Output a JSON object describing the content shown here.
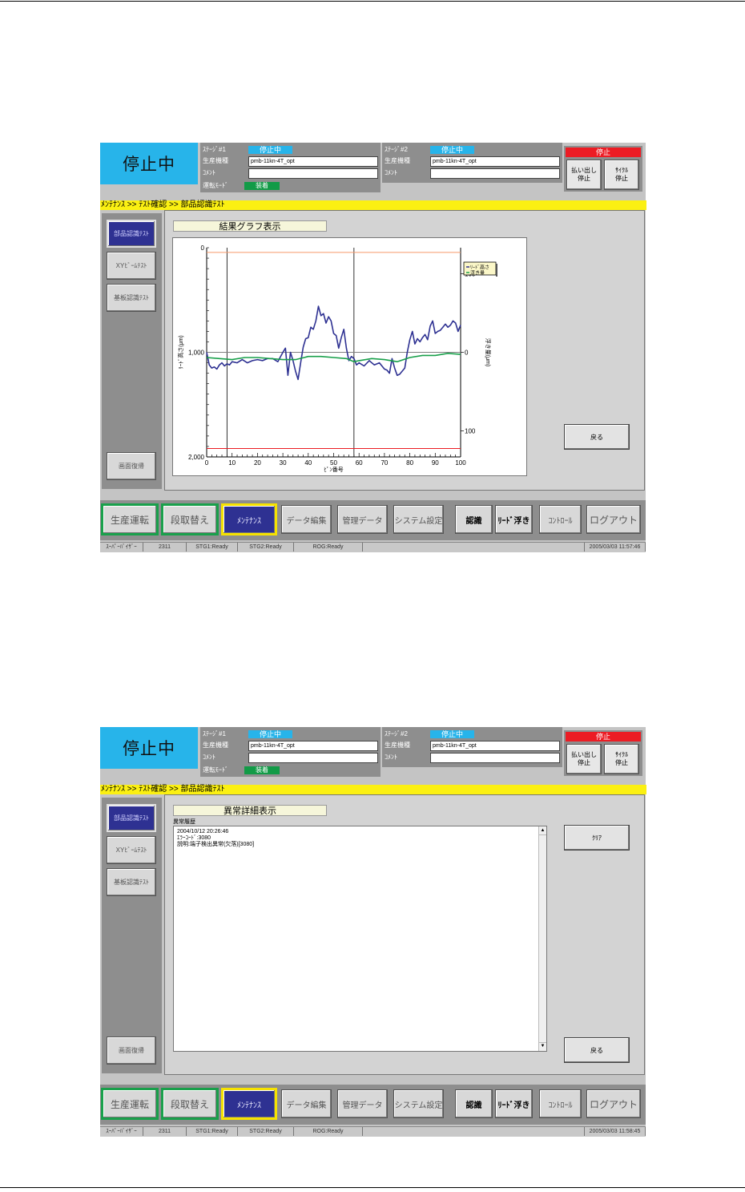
{
  "screens": [
    {
      "status_display": "停止中",
      "stage1": {
        "label": "ｽﾃｰｼﾞ#1",
        "status": "停止中",
        "product_label": "生産機種",
        "product": "pmb-11kn-4T_opt",
        "comment_label": "ｺﾒﾝﾄ",
        "comment": ""
      },
      "stage2": {
        "label": "ｽﾃｰｼﾞ#2",
        "status": "停止中",
        "product_label": "生産機種",
        "product": "pmb-11kn-4T_opt",
        "comment_label": "ｺﾒﾝﾄ",
        "comment": ""
      },
      "run_mode_label": "運転ﾓｰﾄﾞ",
      "run_mode_value": "装着",
      "stop_banner": "停止",
      "payout_stop": {
        "line1": "払い出し",
        "line2": "停止"
      },
      "cycle_stop": {
        "line1": "ｻｲｸﾙ",
        "line2": "停止"
      },
      "breadcrumb": "ﾒﾝﾃﾅﾝｽ >> ﾃｽﾄ確認 >> 部品認識ﾃｽﾄ",
      "sidebar": [
        "部品認識ﾃｽﾄ",
        "XYﾋﾞｰﾑﾃｽﾄ",
        "基板認識ﾃｽﾄ"
      ],
      "restore_button": "画面復帰",
      "section_title": "結果グラフ表示",
      "back_button": "戻る",
      "nav": [
        "生産運転",
        "段取替え",
        "ﾒﾝﾃﾅﾝｽ",
        "データ編集",
        "管理データ",
        "システム設定",
        "認識",
        "ﾘｰﾄﾞ浮き",
        "ｺﾝﾄﾛｰﾙ",
        "ログアウト"
      ],
      "statusbar": [
        "ｽｰﾊﾟｰﾊﾞｲｻﾞｰ",
        "2311",
        "STG1:Ready",
        "STG2:Ready",
        "ROG:Ready",
        "",
        "2005/03/03 11:57:46"
      ]
    },
    {
      "status_display": "停止中",
      "stage1": {
        "label": "ｽﾃｰｼﾞ#1",
        "status": "停止中",
        "product_label": "生産機種",
        "product": "pmb-11kn-4T_opt",
        "comment_label": "ｺﾒﾝﾄ",
        "comment": ""
      },
      "stage2": {
        "label": "ｽﾃｰｼﾞ#2",
        "status": "停止中",
        "product_label": "生産機種",
        "product": "pmb-11kn-4T_opt",
        "comment_label": "ｺﾒﾝﾄ",
        "comment": ""
      },
      "run_mode_label": "運転ﾓｰﾄﾞ",
      "run_mode_value": "装着",
      "stop_banner": "停止",
      "payout_stop": {
        "line1": "払い出し",
        "line2": "停止"
      },
      "cycle_stop": {
        "line1": "ｻｲｸﾙ",
        "line2": "停止"
      },
      "breadcrumb": "ﾒﾝﾃﾅﾝｽ >> ﾃｽﾄ確認 >> 部品認識ﾃｽﾄ",
      "sidebar": [
        "部品認識ﾃｽﾄ",
        "XYﾋﾞｰﾑﾃｽﾄ",
        "基板認識ﾃｽﾄ"
      ],
      "restore_button": "画面復帰",
      "section_title": "異常詳細表示",
      "log_label": "異常履歴",
      "log_lines": [
        "2004/10/12 20:26:46",
        "ｴﾗｰｺｰﾄﾞ:3080",
        "説明:端子検出異常(欠落)[3080]"
      ],
      "clear_button": "ｸﾘｱ",
      "back_button": "戻る",
      "nav": [
        "生産運転",
        "段取替え",
        "ﾒﾝﾃﾅﾝｽ",
        "データ編集",
        "管理データ",
        "システム設定",
        "認識",
        "ﾘｰﾄﾞ浮き",
        "ｺﾝﾄﾛｰﾙ",
        "ログアウト"
      ],
      "statusbar": [
        "ｽｰﾊﾟｰﾊﾞｲｻﾞｰ",
        "2311",
        "STG1:Ready",
        "STG2:Ready",
        "ROG:Ready",
        "",
        "2005/03/03 11:58:45"
      ]
    }
  ],
  "chart_data": {
    "type": "line",
    "xlabel": "ﾋﾟﾝ番号",
    "ylabel_left": "ﾘｰﾄﾞ高さ(μm)",
    "ylabel_right": "浮き量(μm)",
    "xlim": [
      0,
      100
    ],
    "x_ticks": [
      "0",
      "10",
      "20",
      "30",
      "40",
      "50",
      "60",
      "70",
      "80",
      "90",
      "100"
    ],
    "ylim_left": [
      2000,
      0
    ],
    "y_ticks_left": [
      "0",
      "1,000",
      "2,000"
    ],
    "ylim_right": [
      -200,
      200
    ],
    "y_ticks_right": [
      "100",
      "0",
      "100"
    ],
    "legend": [
      "ﾘｰﾄﾞ高さ",
      "浮き量"
    ],
    "legend_position": "top-right",
    "vertical_lines_x": [
      8,
      58
    ],
    "horizontal_lines": [
      {
        "y": 45,
        "color": "#f79a6a"
      },
      {
        "y": 1000,
        "color": "#808080"
      },
      {
        "y": 1920,
        "color": "#ec1c24"
      }
    ],
    "series": [
      {
        "name": "ﾘｰﾄﾞ高さ",
        "color": "#2e3192",
        "x": [
          0,
          1,
          2,
          3,
          4,
          5,
          6,
          7,
          8,
          9,
          10,
          12,
          14,
          16,
          18,
          20,
          22,
          24,
          26,
          28,
          30,
          31,
          32,
          33,
          34,
          35,
          36,
          37,
          38,
          39,
          40,
          41,
          42,
          43,
          44,
          45,
          46,
          47,
          48,
          49,
          50,
          51,
          52,
          53,
          54,
          55,
          56,
          57,
          58,
          59,
          60,
          62,
          64,
          66,
          68,
          70,
          71,
          72,
          73,
          74,
          75,
          76,
          77,
          78,
          79,
          80,
          81,
          82,
          83,
          84,
          85,
          86,
          87,
          88,
          89,
          90,
          91,
          92,
          93,
          94,
          95,
          96,
          97,
          98,
          99,
          100
        ],
        "y": [
          1000,
          1120,
          1150,
          1140,
          1160,
          1120,
          1100,
          1130,
          1110,
          1120,
          1090,
          1100,
          1070,
          1100,
          1080,
          1070,
          1080,
          1060,
          1060,
          1090,
          1000,
          960,
          1220,
          1000,
          1080,
          1180,
          1260,
          1100,
          950,
          870,
          860,
          760,
          780,
          700,
          560,
          650,
          630,
          720,
          660,
          700,
          820,
          840,
          960,
          860,
          780,
          960,
          1080,
          1040,
          1060,
          1120,
          1100,
          1130,
          1080,
          1120,
          1100,
          1160,
          1170,
          1200,
          1060,
          1150,
          1220,
          1210,
          1180,
          1150,
          1000,
          880,
          800,
          920,
          870,
          900,
          860,
          830,
          880,
          750,
          700,
          820,
          800,
          790,
          760,
          730,
          760,
          740,
          700,
          720,
          800,
          740
        ]
      },
      {
        "name": "浮き量",
        "color": "#19a04b",
        "x": [
          0,
          5,
          10,
          15,
          20,
          25,
          30,
          35,
          40,
          45,
          50,
          55,
          58,
          60,
          65,
          70,
          75,
          80,
          85,
          90,
          95,
          100
        ],
        "y": [
          1050,
          1060,
          1070,
          1050,
          1050,
          1060,
          1070,
          1070,
          1040,
          1040,
          1050,
          1060,
          1090,
          1080,
          1060,
          1070,
          1090,
          1050,
          1030,
          1030,
          1010,
          1020
        ]
      }
    ]
  }
}
